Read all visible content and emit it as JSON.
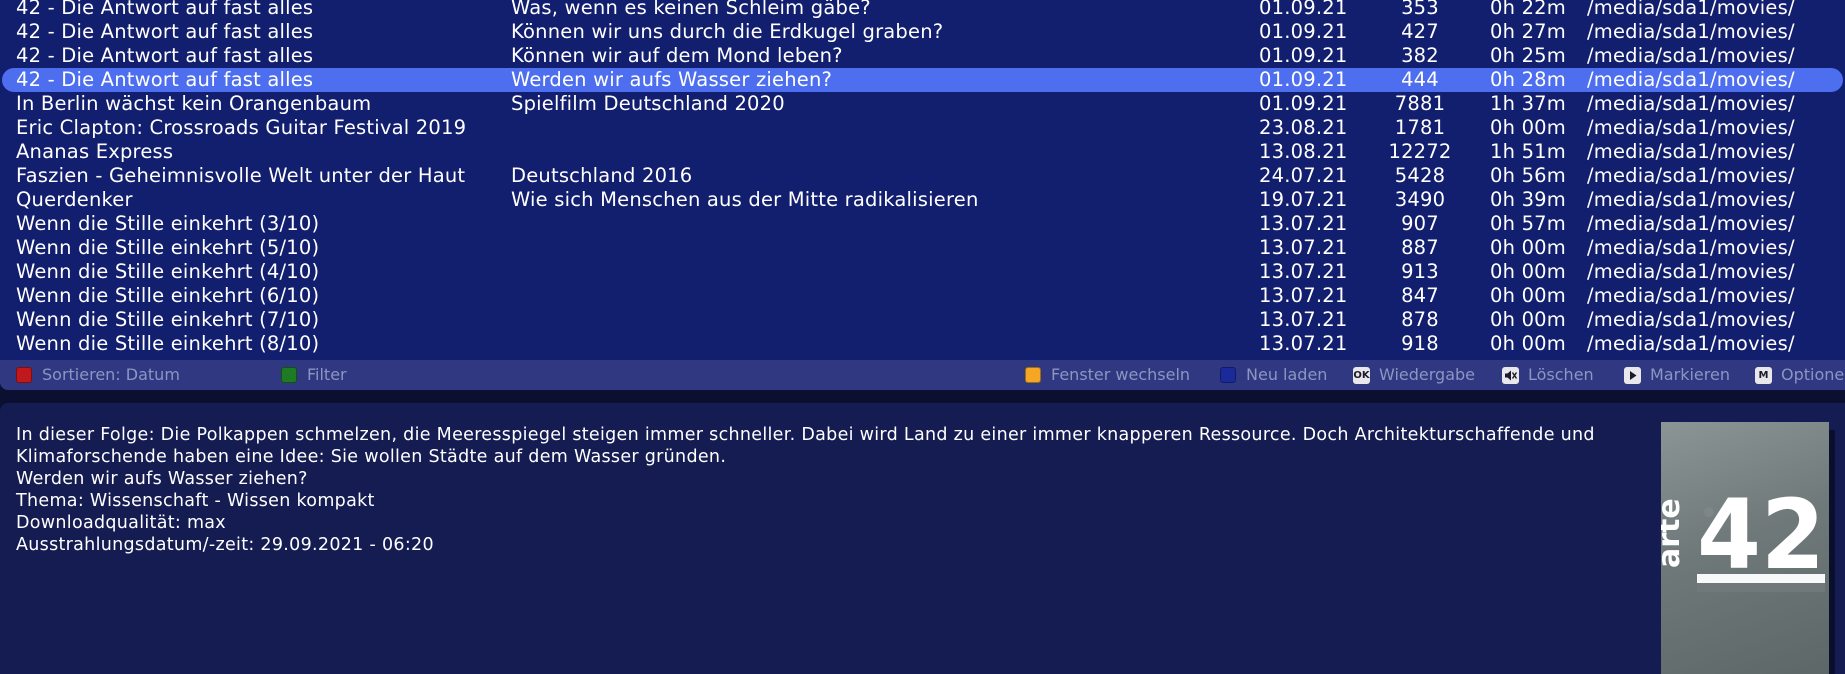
{
  "recordings": [
    {
      "title": "42 - Die Antwort auf fast alles",
      "subtitle": "Was, wenn es keinen Schleim gäbe?",
      "date": "01.09.21",
      "size": "353",
      "duration": "0h 22m",
      "path": "/media/sda1/movies/",
      "selected": false
    },
    {
      "title": "42 - Die Antwort auf fast alles",
      "subtitle": "Können wir uns durch die Erdkugel graben?",
      "date": "01.09.21",
      "size": "427",
      "duration": "0h 27m",
      "path": "/media/sda1/movies/",
      "selected": false
    },
    {
      "title": "42 - Die Antwort auf fast alles",
      "subtitle": "Können wir auf dem Mond leben?",
      "date": "01.09.21",
      "size": "382",
      "duration": "0h 25m",
      "path": "/media/sda1/movies/",
      "selected": false
    },
    {
      "title": "42 - Die Antwort auf fast alles",
      "subtitle": "Werden wir aufs Wasser ziehen?",
      "date": "01.09.21",
      "size": "444",
      "duration": "0h 28m",
      "path": "/media/sda1/movies/",
      "selected": true
    },
    {
      "title": "In Berlin wächst kein Orangenbaum",
      "subtitle": "Spielfilm Deutschland 2020",
      "date": "01.09.21",
      "size": "7881",
      "duration": "1h 37m",
      "path": "/media/sda1/movies/",
      "selected": false
    },
    {
      "title": "Eric Clapton: Crossroads Guitar Festival 2019",
      "subtitle": "",
      "date": "23.08.21",
      "size": "1781",
      "duration": "0h 00m",
      "path": "/media/sda1/movies/",
      "selected": false
    },
    {
      "title": "Ananas Express",
      "subtitle": "",
      "date": "13.08.21",
      "size": "12272",
      "duration": "1h 51m",
      "path": "/media/sda1/movies/",
      "selected": false
    },
    {
      "title": "Faszien - Geheimnisvolle Welt unter der Haut",
      "subtitle": "Deutschland 2016",
      "date": "24.07.21",
      "size": "5428",
      "duration": "0h 56m",
      "path": "/media/sda1/movies/",
      "selected": false
    },
    {
      "title": "Querdenker",
      "subtitle": "Wie sich Menschen aus der Mitte radikalisieren",
      "date": "19.07.21",
      "size": "3490",
      "duration": "0h 39m",
      "path": "/media/sda1/movies/",
      "selected": false
    },
    {
      "title": "Wenn die Stille einkehrt (3/10)",
      "subtitle": "",
      "date": "13.07.21",
      "size": "907",
      "duration": "0h 57m",
      "path": "/media/sda1/movies/",
      "selected": false
    },
    {
      "title": "Wenn die Stille einkehrt (5/10)",
      "subtitle": "",
      "date": "13.07.21",
      "size": "887",
      "duration": "0h 00m",
      "path": "/media/sda1/movies/",
      "selected": false
    },
    {
      "title": "Wenn die Stille einkehrt (4/10)",
      "subtitle": "",
      "date": "13.07.21",
      "size": "913",
      "duration": "0h 00m",
      "path": "/media/sda1/movies/",
      "selected": false
    },
    {
      "title": "Wenn die Stille einkehrt (6/10)",
      "subtitle": "",
      "date": "13.07.21",
      "size": "847",
      "duration": "0h 00m",
      "path": "/media/sda1/movies/",
      "selected": false
    },
    {
      "title": "Wenn die Stille einkehrt (7/10)",
      "subtitle": "",
      "date": "13.07.21",
      "size": "878",
      "duration": "0h 00m",
      "path": "/media/sda1/movies/",
      "selected": false
    },
    {
      "title": "Wenn die Stille einkehrt (8/10)",
      "subtitle": "",
      "date": "13.07.21",
      "size": "918",
      "duration": "0h 00m",
      "path": "/media/sda1/movies/",
      "selected": false
    }
  ],
  "buttons": {
    "red": {
      "label": "Sortieren: Datum",
      "color": "#c0181c",
      "icon": "red-button-icon"
    },
    "green": {
      "label": "Filter",
      "color": "#1f7a24",
      "icon": "green-button-icon"
    },
    "yellow": {
      "label": "Fenster wechseln",
      "color": "#f5a623",
      "icon": "yellow-button-icon"
    },
    "blue": {
      "label": "Neu laden",
      "color": "#1b2a9a",
      "icon": "blue-button-icon"
    },
    "ok": {
      "label": "Wiedergabe",
      "key": "OK",
      "icon": "ok-key-icon"
    },
    "mute": {
      "label": "Löschen",
      "icon": "mute-key-icon"
    },
    "play": {
      "label": "Markieren",
      "icon": "play-key-icon"
    },
    "menu": {
      "label": "Optionen",
      "key": "M",
      "icon": "menu-key-icon"
    }
  },
  "info": {
    "description": "In dieser Folge: Die Polkappen schmelzen, die Meeresspiegel steigen immer schneller. Dabei wird Land zu einer immer knapperen Ressource. Doch Architekturschaffende und Klimaforschende haben eine Idee: Sie wollen Städte auf dem Wasser gründen.",
    "episode": "Werden wir aufs Wasser ziehen?",
    "topic": "Thema: Wissenschaft - Wissen kompakt",
    "quality": "Downloadqualität: max",
    "airdate": "Ausstrahlungsdatum/-zeit: 29.09.2021 - 06:20"
  },
  "thumbnail": {
    "brand": "arte",
    "number": "42",
    "icon": "arte-42-thumbnail"
  },
  "colors": {
    "list_bg": "#121e6e",
    "selected_bg": "#4e6ef0",
    "bar_bg": "#2f3880",
    "info_bg": "#141c52"
  }
}
